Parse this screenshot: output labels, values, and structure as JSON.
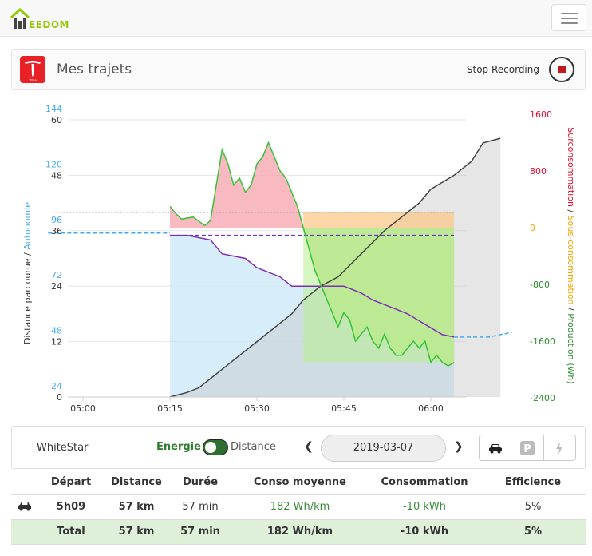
{
  "app": {
    "logo_text": "EEDOM"
  },
  "panel": {
    "title": "Mes trajets",
    "stop_label": "Stop Recording",
    "brand_icon": "tesla-logo-icon",
    "brand_sub": "TESLA"
  },
  "chart_data": {
    "type": "area",
    "x_ticks": [
      "05:00",
      "05:15",
      "05:30",
      "05:45",
      "06:00"
    ],
    "left_axis_label_a": "Distance parcourue",
    "left_axis_label_sep": " / ",
    "left_axis_label_b": "Autonomie",
    "right_axis_label_red": "Surconsommation",
    "right_axis_label_sep1": " / ",
    "right_axis_label_orange": "Sous-consommation",
    "right_axis_label_sep2": " / ",
    "right_axis_label_green": "Production (Wh)",
    "distance_ticks": [
      "0",
      "12",
      "24",
      "36",
      "48",
      "60"
    ],
    "autonomie_ticks": [
      "24",
      "48",
      "72",
      "96",
      "120",
      "144"
    ],
    "energy_ticks": [
      "-2400",
      "-1600",
      "-800",
      "0",
      "800",
      "1600"
    ],
    "ylim_distance": [
      0,
      60
    ],
    "ylim_autonomie": [
      24,
      144
    ],
    "ylim_energy": [
      -2400,
      1600
    ],
    "time_range_minutes": [
      0,
      72
    ],
    "series": [
      {
        "name": "Distance parcourue",
        "color": "#444444",
        "points": [
          [
            15,
            0
          ],
          [
            18,
            1
          ],
          [
            20,
            2
          ],
          [
            22,
            4
          ],
          [
            24,
            6
          ],
          [
            27,
            9
          ],
          [
            30,
            12
          ],
          [
            33,
            15
          ],
          [
            36,
            18
          ],
          [
            38,
            21
          ],
          [
            41,
            24
          ],
          [
            44,
            26
          ],
          [
            48,
            31
          ],
          [
            52,
            36
          ],
          [
            55,
            39
          ],
          [
            58,
            42
          ],
          [
            60,
            45
          ],
          [
            64,
            48
          ],
          [
            67,
            51
          ],
          [
            69,
            55
          ],
          [
            72,
            56
          ]
        ]
      },
      {
        "name": "Autonomie",
        "color": "#7e2fb9",
        "points": [
          [
            15,
            94
          ],
          [
            18,
            94
          ],
          [
            20,
            93
          ],
          [
            22,
            92
          ],
          [
            24,
            86
          ],
          [
            26,
            85
          ],
          [
            28,
            84
          ],
          [
            30,
            80
          ],
          [
            32,
            78
          ],
          [
            34,
            76
          ],
          [
            36,
            72
          ],
          [
            38,
            72
          ],
          [
            41,
            72
          ],
          [
            44,
            72
          ],
          [
            45,
            72
          ],
          [
            46,
            71
          ],
          [
            48,
            69
          ],
          [
            50,
            66
          ],
          [
            52,
            64
          ],
          [
            54,
            62
          ],
          [
            56,
            60
          ],
          [
            58,
            57
          ],
          [
            60,
            54
          ],
          [
            62,
            51
          ],
          [
            64,
            50
          ]
        ]
      },
      {
        "name": "Autonomie projetée",
        "color": "#44aaee",
        "points": [
          [
            -6,
            95
          ],
          [
            15,
            95
          ]
        ]
      },
      {
        "name": "Energie",
        "color": "#36c236",
        "points": [
          [
            15,
            300
          ],
          [
            16,
            200
          ],
          [
            17,
            120
          ],
          [
            19,
            150
          ],
          [
            21,
            30
          ],
          [
            22,
            100
          ],
          [
            23,
            600
          ],
          [
            24,
            1100
          ],
          [
            25,
            900
          ],
          [
            26,
            600
          ],
          [
            27,
            700
          ],
          [
            28,
            500
          ],
          [
            29,
            600
          ],
          [
            30,
            900
          ],
          [
            31,
            1000
          ],
          [
            32,
            1200
          ],
          [
            33,
            1000
          ],
          [
            34,
            800
          ],
          [
            35,
            700
          ],
          [
            36,
            500
          ],
          [
            37,
            300
          ],
          [
            38,
            0
          ],
          [
            39,
            -300
          ],
          [
            40,
            -600
          ],
          [
            41,
            -800
          ],
          [
            42,
            -1000
          ],
          [
            43,
            -1200
          ],
          [
            44,
            -1400
          ],
          [
            45,
            -1200
          ],
          [
            46,
            -1300
          ],
          [
            47,
            -1600
          ],
          [
            48,
            -1500
          ],
          [
            49,
            -1400
          ],
          [
            50,
            -1600
          ],
          [
            51,
            -1700
          ],
          [
            52,
            -1500
          ],
          [
            53,
            -1700
          ],
          [
            54,
            -1800
          ],
          [
            55,
            -1800
          ],
          [
            56,
            -1700
          ],
          [
            57,
            -1600
          ],
          [
            58,
            -1700
          ],
          [
            59,
            -1600
          ],
          [
            60,
            -1900
          ],
          [
            61,
            -1800
          ],
          [
            62,
            -1900
          ],
          [
            63,
            -1950
          ],
          [
            64,
            -1900
          ]
        ]
      }
    ]
  },
  "controls": {
    "vehicle": "WhiteStar",
    "toggle_left": "Energie",
    "toggle_right": "Distance",
    "date": "2019-03-07",
    "prev_icon": "chevron-left-icon",
    "next_icon": "chevron-right-icon",
    "mode_icons": [
      "car-icon",
      "parking-icon",
      "lightning-icon"
    ]
  },
  "table": {
    "headers": [
      "",
      "Départ",
      "Distance",
      "Durée",
      "Conso moyenne",
      "Consommation",
      "Efficience"
    ],
    "row": {
      "icon": "car-icon",
      "depart": "5h09",
      "distance": "57 km",
      "duree": "57 min",
      "conso": "182 Wh/km",
      "consommation": "-10 kWh",
      "efficience": "5%"
    },
    "total": {
      "label": "Total",
      "distance": "57 km",
      "duree": "57 min",
      "conso": "182 Wh/km",
      "consommation": "-10 kWh",
      "efficience": "5%"
    }
  },
  "colors": {
    "accent_green": "#94ca02",
    "surconso": "#e00b2e",
    "sousconso": "#f5a300",
    "production": "#2e8b2e",
    "autonomie": "#44aaee"
  }
}
